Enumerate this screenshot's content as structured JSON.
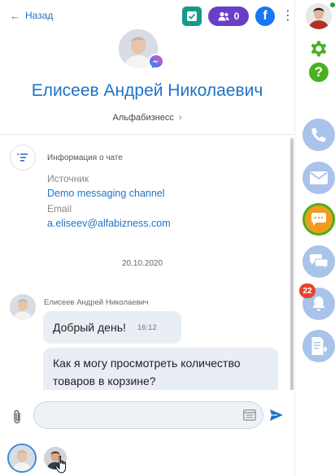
{
  "header": {
    "back_label": "Назад",
    "contacts_count": "0",
    "facebook_letter": "f"
  },
  "contact": {
    "name": "Елисеев Андрей Николаевич",
    "company": "Альфабизнесс",
    "company_chevron": "›"
  },
  "chat_info": {
    "title": "Информация о чате",
    "source_label": "Источник",
    "source_value": "Demo messaging channel",
    "email_label": "Email",
    "email_value": "a.eliseev@alfabizness.com"
  },
  "messages": {
    "date": "20.10.2020",
    "sender": "Елисеев Андрей Николаевич",
    "items": [
      {
        "text": "Добрый день!",
        "time": "16:12"
      },
      {
        "text": "Как я могу просмотреть количество товаров в корзине?"
      }
    ]
  },
  "composer": {
    "placeholder": ""
  },
  "sidebar": {
    "help_label": "?",
    "notifications_count": "22"
  },
  "colors": {
    "accent_blue": "#1e73c8",
    "teal": "#169a88",
    "purple": "#6a3fc5",
    "facebook": "#1877f2",
    "green": "#4caf22",
    "orange": "#f29c1f",
    "side_button": "#a9c3ea",
    "badge_red": "#e84330"
  },
  "icons": {
    "back": "arrow-left-icon",
    "attach": "paperclip-icon",
    "send": "send-icon",
    "templates": "template-list-icon"
  }
}
